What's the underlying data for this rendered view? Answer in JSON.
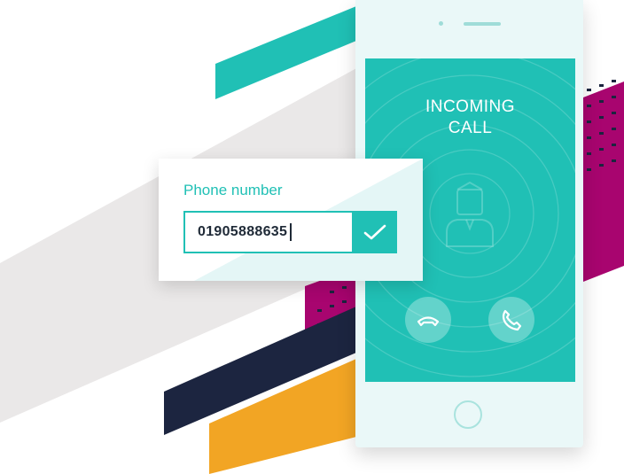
{
  "call_screen": {
    "title_line1": "INCOMING",
    "title_line2": "CALL"
  },
  "phone_form": {
    "label": "Phone number",
    "value": "01905888635"
  },
  "icons": [
    "avatar-icon",
    "hang-up-icon",
    "answer-call-icon",
    "checkmark-icon",
    "home-button"
  ],
  "colors": {
    "teal": "#20c0b5",
    "magenta": "#a8056f",
    "navy": "#1c2540",
    "orange": "#f2a524",
    "light_gray": "#eae8e8"
  }
}
